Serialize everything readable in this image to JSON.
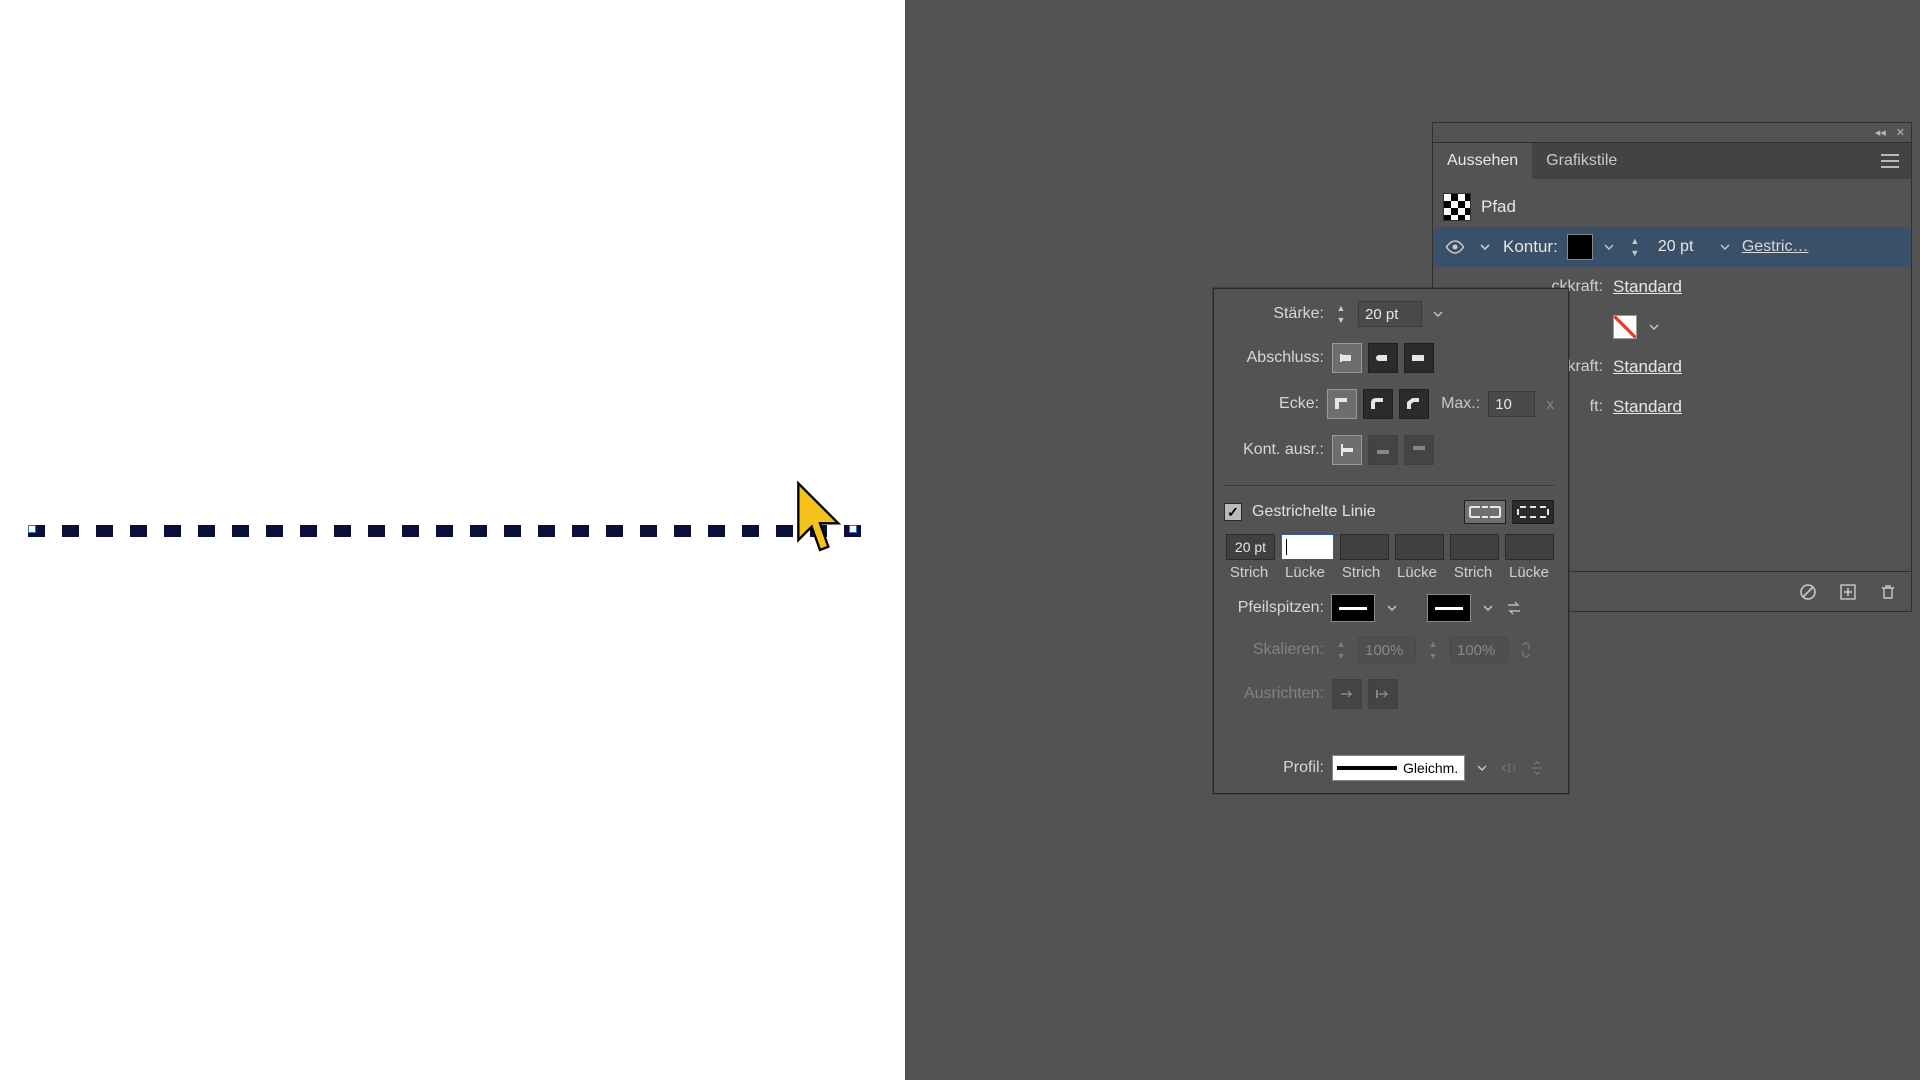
{
  "canvas": {
    "object": "dashed-path"
  },
  "appearance": {
    "collapse_glyph": "◂◂",
    "close_glyph": "✕",
    "tabs": {
      "active": "Aussehen",
      "other": "Grafikstile"
    },
    "type_label": "Pfad",
    "stroke": {
      "name": "Kontur:",
      "weight": "20 pt",
      "link": "Gestric…"
    },
    "rows": {
      "opacity1_label": "ckkraft:",
      "opacity1_value": "Standard",
      "opacity2_label": "ckkraft:",
      "opacity2_value": "Standard",
      "opacity3_label": "ft:",
      "opacity3_value": "Standard"
    }
  },
  "stroke_panel": {
    "weight_label": "Stärke:",
    "weight_value": "20 pt",
    "cap_label": "Abschluss:",
    "corner_label": "Ecke:",
    "limit_label": "Max.:",
    "limit_value": "10",
    "limit_x": "x",
    "align_label": "Kont. ausr.:",
    "dashed_check": "Gestrichelte Linie",
    "dash_val": "20 pt",
    "dash_labels": [
      "Strich",
      "Lücke",
      "Strich",
      "Lücke",
      "Strich",
      "Lücke"
    ],
    "arrow_label": "Pfeilspitzen:",
    "scale_label": "Skalieren:",
    "scale_v1": "100%",
    "scale_v2": "100%",
    "align_arrow_label": "Ausrichten:",
    "profile_label": "Profil:",
    "profile_value": "Gleichm."
  }
}
